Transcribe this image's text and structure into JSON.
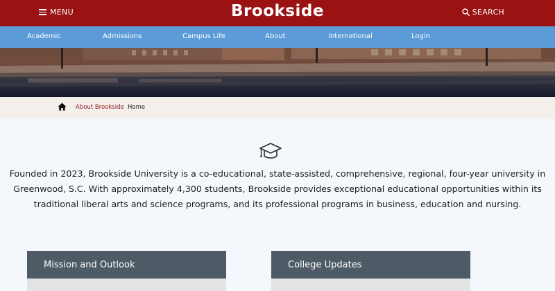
{
  "header": {
    "menu_label": "MENU",
    "brand": "Brookside",
    "search_label": "SEARCH",
    "bg_color": "#9b1212"
  },
  "nav": {
    "bg_color": "#5b9bd8",
    "items": [
      {
        "label": "Academic"
      },
      {
        "label": "Admissions"
      },
      {
        "label": "Campus Life"
      },
      {
        "label": "About"
      },
      {
        "label": "International"
      },
      {
        "label": "Login"
      }
    ]
  },
  "breadcrumb": {
    "link": "About Brookside",
    "current": "Home"
  },
  "main": {
    "icon": "graduation-cap-icon",
    "intro": "Founded in 2023, Brookside University is a co-educational, state-assisted, comprehensive, regional, four-year university in Greenwood, S.C. With approximately 4,300 students, Brookside provides exceptional educational opportunities within its traditional liberal arts and science programs, and its professional programs in business, education and nursing."
  },
  "cards": [
    {
      "title": "Mission and Outlook"
    },
    {
      "title": "College Updates"
    }
  ]
}
